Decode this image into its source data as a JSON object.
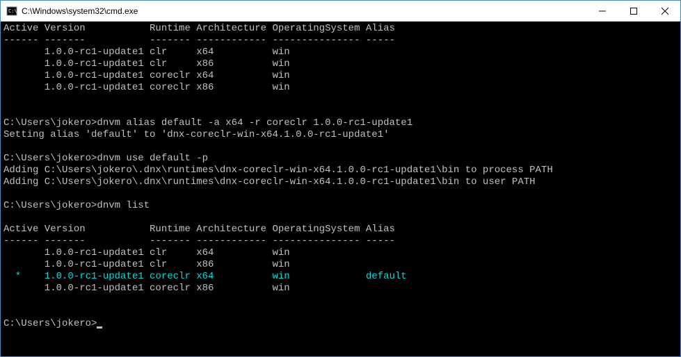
{
  "window": {
    "title": "C:\\Windows\\system32\\cmd.exe"
  },
  "terminal": {
    "table1": {
      "headers": {
        "active": "Active",
        "version": "Version",
        "runtime": "Runtime",
        "architecture": "Architecture",
        "os": "OperatingSystem",
        "alias": "Alias"
      },
      "dividers": {
        "active": "------",
        "version": "-------",
        "runtime": "-------",
        "architecture": "------------",
        "os": "---------------",
        "alias": "-----"
      },
      "rows": [
        {
          "active": "",
          "version": "1.0.0-rc1-update1",
          "runtime": "clr",
          "architecture": "x64",
          "os": "win",
          "alias": ""
        },
        {
          "active": "",
          "version": "1.0.0-rc1-update1",
          "runtime": "clr",
          "architecture": "x86",
          "os": "win",
          "alias": ""
        },
        {
          "active": "",
          "version": "1.0.0-rc1-update1",
          "runtime": "coreclr",
          "architecture": "x64",
          "os": "win",
          "alias": ""
        },
        {
          "active": "",
          "version": "1.0.0-rc1-update1",
          "runtime": "coreclr",
          "architecture": "x86",
          "os": "win",
          "alias": ""
        }
      ]
    },
    "cmd1": {
      "prompt": "C:\\Users\\jokero>",
      "command": "dnvm alias default -a x64 -r coreclr 1.0.0-rc1-update1"
    },
    "output1": "Setting alias 'default' to 'dnx-coreclr-win-x64.1.0.0-rc1-update1'",
    "cmd2": {
      "prompt": "C:\\Users\\jokero>",
      "command": "dnvm use default -p"
    },
    "output2a": "Adding C:\\Users\\jokero\\.dnx\\runtimes\\dnx-coreclr-win-x64.1.0.0-rc1-update1\\bin to process PATH",
    "output2b": "Adding C:\\Users\\jokero\\.dnx\\runtimes\\dnx-coreclr-win-x64.1.0.0-rc1-update1\\bin to user PATH",
    "cmd3": {
      "prompt": "C:\\Users\\jokero>",
      "command": "dnvm list"
    },
    "table2": {
      "headers": {
        "active": "Active",
        "version": "Version",
        "runtime": "Runtime",
        "architecture": "Architecture",
        "os": "OperatingSystem",
        "alias": "Alias"
      },
      "dividers": {
        "active": "------",
        "version": "-------",
        "runtime": "-------",
        "architecture": "------------",
        "os": "---------------",
        "alias": "-----"
      },
      "rows": [
        {
          "active": "",
          "version": "1.0.0-rc1-update1",
          "runtime": "clr",
          "architecture": "x64",
          "os": "win",
          "alias": "",
          "highlight": false
        },
        {
          "active": "",
          "version": "1.0.0-rc1-update1",
          "runtime": "clr",
          "architecture": "x86",
          "os": "win",
          "alias": "",
          "highlight": false
        },
        {
          "active": "  *",
          "version": "1.0.0-rc1-update1",
          "runtime": "coreclr",
          "architecture": "x64",
          "os": "win",
          "alias": "default",
          "highlight": true
        },
        {
          "active": "",
          "version": "1.0.0-rc1-update1",
          "runtime": "coreclr",
          "architecture": "x86",
          "os": "win",
          "alias": "",
          "highlight": false
        }
      ]
    },
    "cmd4": {
      "prompt": "C:\\Users\\jokero>"
    }
  }
}
